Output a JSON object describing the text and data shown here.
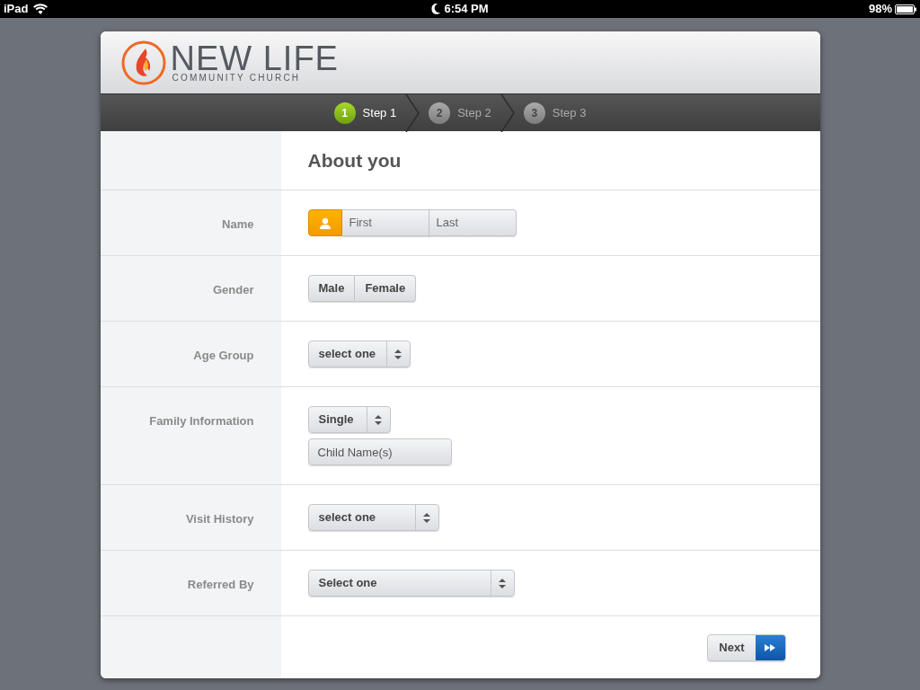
{
  "status_bar": {
    "device": "iPad",
    "time": "6:54 PM",
    "battery": "98%"
  },
  "logo": {
    "name": "NEW LIFE",
    "tagline": "COMMUNITY CHURCH"
  },
  "steps": [
    {
      "number": "1",
      "label": "Step 1",
      "selected": true
    },
    {
      "number": "2",
      "label": "Step 2",
      "selected": false
    },
    {
      "number": "3",
      "label": "Step 3",
      "selected": false
    }
  ],
  "form": {
    "title": "About you",
    "rows": [
      {
        "label": "Name",
        "kind": "name",
        "fields": [
          {
            "placeholder": "First"
          },
          {
            "placeholder": "Last"
          }
        ]
      },
      {
        "label": "Gender",
        "kind": "segmented",
        "options": [
          {
            "label": "Male",
            "selected": false
          },
          {
            "label": "Female",
            "selected": false
          }
        ]
      },
      {
        "label": "Age Group",
        "kind": "select",
        "value": "select one"
      },
      {
        "label": "Family Information",
        "kind": "select_text",
        "value": "Single",
        "placeholder": "Child Name(s)"
      },
      {
        "label": "Visit History",
        "kind": "select",
        "value": "select one"
      },
      {
        "label": "Referred By",
        "kind": "select",
        "value": "Select one"
      }
    ]
  },
  "next_button": {
    "label": "Next"
  }
}
